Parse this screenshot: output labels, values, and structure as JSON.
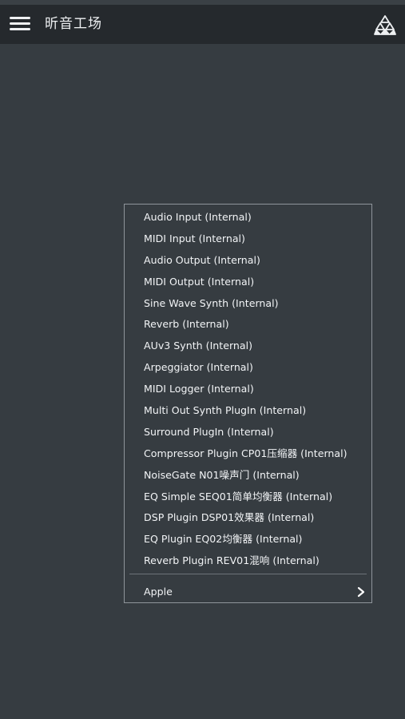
{
  "header": {
    "title": "昕音工场",
    "menu_icon": "hamburger-menu-icon",
    "logo_icon": "triangle-cluster-logo-icon"
  },
  "popup": {
    "items": [
      "Audio Input (Internal)",
      "MIDI Input (Internal)",
      "Audio Output (Internal)",
      "MIDI Output (Internal)",
      "Sine Wave Synth (Internal)",
      "Reverb (Internal)",
      "AUv3 Synth (Internal)",
      "Arpeggiator (Internal)",
      "MIDI Logger (Internal)",
      "Multi Out Synth PlugIn (Internal)",
      "Surround PlugIn (Internal)",
      "Compressor Plugin CP01压缩器 (Internal)",
      "NoiseGate N01噪声门 (Internal)",
      "EQ Simple SEQ01简单均衡器 (Internal)",
      "DSP Plugin DSP01效果器 (Internal)",
      "EQ Plugin EQ02均衡器 (Internal)",
      "Reverb Plugin REV01混响 (Internal)"
    ],
    "submenu": {
      "label": "Apple",
      "icon": "chevron-right-icon"
    }
  },
  "colors": {
    "background": "#363c41",
    "header": "#25292d",
    "popup_border": "#8f959b",
    "text": "#f2f4f6"
  }
}
